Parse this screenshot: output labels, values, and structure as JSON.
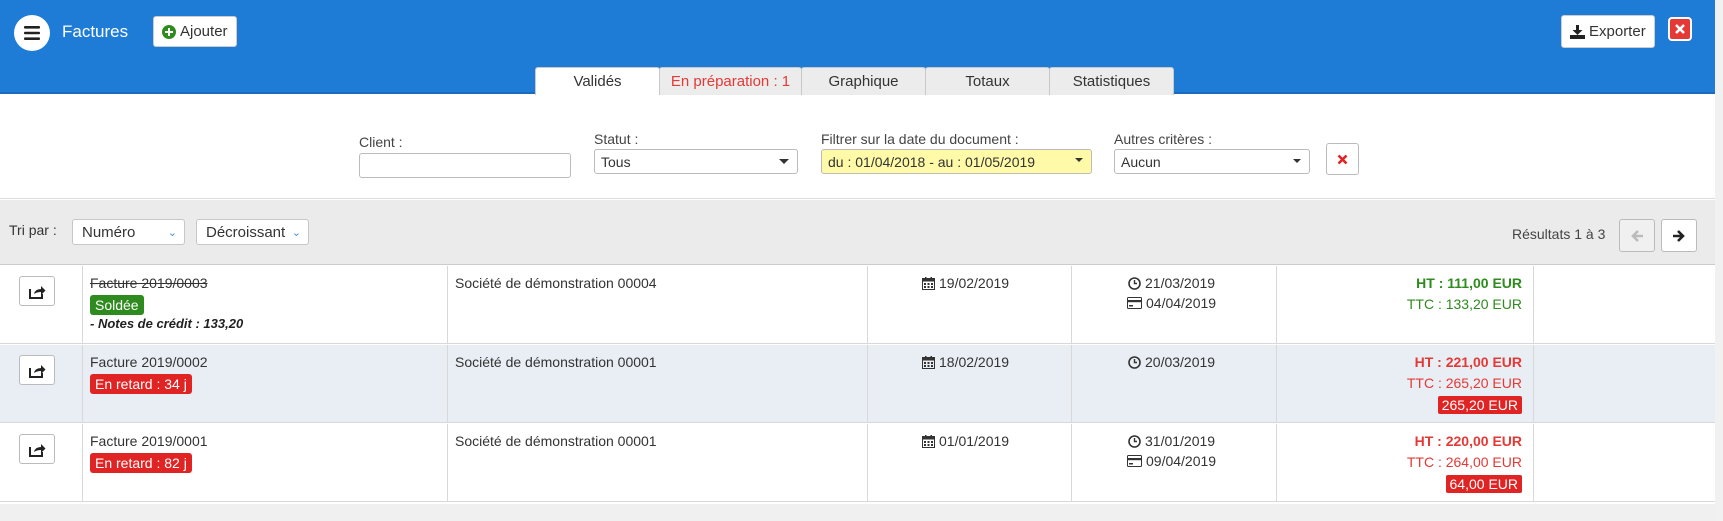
{
  "header": {
    "title": "Factures",
    "add_label": "Ajouter",
    "export_label": "Exporter"
  },
  "tabs": [
    {
      "label": "Validés",
      "active": true
    },
    {
      "label": "En préparation : 1",
      "warn": true
    },
    {
      "label": "Graphique"
    },
    {
      "label": "Totaux"
    },
    {
      "label": "Statistiques"
    }
  ],
  "filters": {
    "client_label": "Client :",
    "client_value": "",
    "status_label": "Statut :",
    "status_value": "Tous",
    "date_label": "Filtrer sur la date du document :",
    "date_value": "du : 01/04/2018 - au : 01/05/2019",
    "other_label": "Autres critères :",
    "other_value": "Aucun"
  },
  "sort": {
    "label": "Tri par :",
    "field": "Numéro",
    "order": "Décroissant",
    "results": "Résultats 1 à 3"
  },
  "colors": {
    "header_bg": "#1e7bd6",
    "accent_green": "#2e8b1e",
    "accent_red": "#e02424",
    "filter_highlight": "#fffaa8"
  },
  "rows": [
    {
      "number": "Facture 2019/0003",
      "status": "Soldée",
      "status_kind": "green",
      "note": "- Notes de crédit : 133,20",
      "client": "Société de démonstration 00004",
      "doc_date": "19/02/2019",
      "due_date": "21/03/2019",
      "paid_date": "04/04/2019",
      "ht": "HT : 111,00 EUR",
      "ttc": "TTC : 133,20 EUR",
      "amount_kind": "green",
      "remaining": ""
    },
    {
      "number": "Facture 2019/0002",
      "status": "En retard : 34 j",
      "status_kind": "red",
      "note": "",
      "client": "Société de démonstration 00001",
      "doc_date": "18/02/2019",
      "due_date": "20/03/2019",
      "paid_date": "",
      "ht": "HT : 221,00 EUR",
      "ttc": "TTC : 265,20 EUR",
      "amount_kind": "red",
      "remaining": "265,20 EUR"
    },
    {
      "number": "Facture 2019/0001",
      "status": "En retard : 82 j",
      "status_kind": "red",
      "note": "",
      "client": "Société de démonstration 00001",
      "doc_date": "01/01/2019",
      "due_date": "31/01/2019",
      "paid_date": "09/04/2019",
      "ht": "HT : 220,00 EUR",
      "ttc": "TTC : 264,00 EUR",
      "amount_kind": "red",
      "remaining": "64,00 EUR"
    }
  ]
}
